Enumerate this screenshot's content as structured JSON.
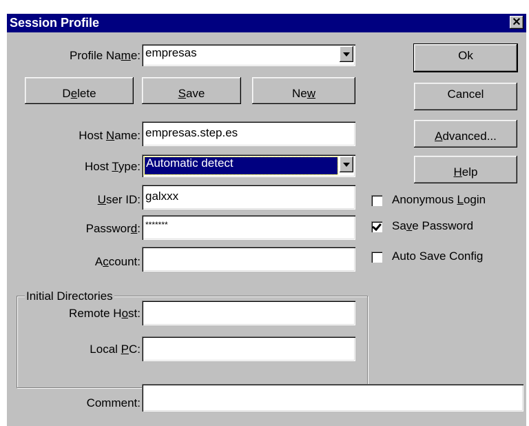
{
  "window": {
    "title": "Session Profile",
    "close_glyph": "✕"
  },
  "fields": {
    "profile_name": {
      "label_pre": "Profile Na",
      "label_key": "m",
      "label_post": "e:",
      "value": "empresas"
    },
    "host_name": {
      "label_pre": "Host ",
      "label_key": "N",
      "label_post": "ame:",
      "value": "empresas.step.es"
    },
    "host_type": {
      "label_pre": "Host ",
      "label_key": "T",
      "label_post": "ype:",
      "value": "Automatic detect"
    },
    "user_id": {
      "label_pre": "",
      "label_key": "U",
      "label_post": "ser ID:",
      "value": "galxxx"
    },
    "password": {
      "label_pre": "Passwor",
      "label_key": "d",
      "label_post": ":",
      "value": "*******"
    },
    "account": {
      "label_pre": "A",
      "label_key": "c",
      "label_post": "count:",
      "value": ""
    },
    "remote_host": {
      "label_pre": "Remote H",
      "label_key": "o",
      "label_post": "st:",
      "value": ""
    },
    "local_pc": {
      "label_pre": "Local ",
      "label_key": "P",
      "label_post": "C:",
      "value": ""
    },
    "comment": {
      "label": "Comment:",
      "value": ""
    }
  },
  "group": {
    "initial_directories": "Initial Directories"
  },
  "buttons": {
    "delete": {
      "pre": "D",
      "key": "e",
      "post": "lete"
    },
    "save": {
      "pre": "",
      "key": "S",
      "post": "ave"
    },
    "new": {
      "pre": "Ne",
      "key": "w",
      "post": ""
    },
    "ok": {
      "label": "Ok"
    },
    "cancel": {
      "label": "Cancel"
    },
    "advanced": {
      "pre": "",
      "key": "A",
      "post": "dvanced..."
    },
    "help": {
      "pre": "",
      "key": "H",
      "post": "elp"
    }
  },
  "checkboxes": {
    "anonymous_login": {
      "pre": "Anonymous ",
      "key": "L",
      "post": "ogin",
      "checked": false
    },
    "save_password": {
      "pre": "Sa",
      "key": "v",
      "post": "e Password",
      "checked": true
    },
    "auto_save_config": {
      "pre": "Auto Save Config",
      "key": "",
      "post": "",
      "checked": false
    }
  }
}
